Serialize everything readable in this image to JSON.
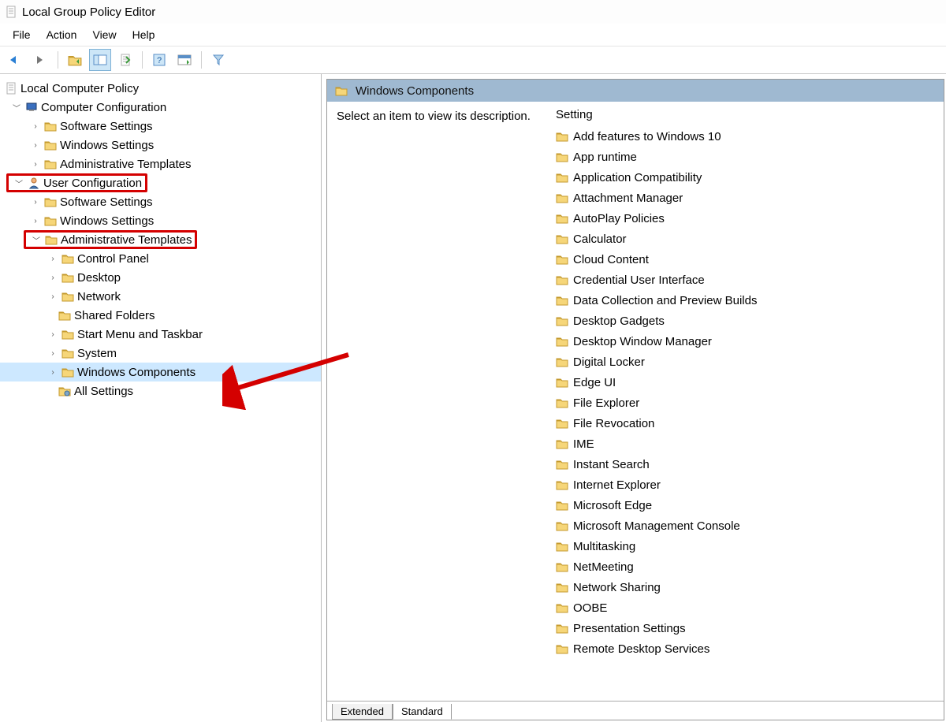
{
  "window": {
    "title": "Local Group Policy Editor"
  },
  "menu": {
    "file": "File",
    "action": "Action",
    "view": "View",
    "help": "Help"
  },
  "tree": {
    "root": "Local Computer Policy",
    "computer": "Computer Configuration",
    "comp_software": "Software Settings",
    "comp_windows": "Windows Settings",
    "comp_admin": "Administrative Templates",
    "user": "User Configuration",
    "user_software": "Software Settings",
    "user_windows": "Windows Settings",
    "user_admin": "Administrative Templates",
    "control_panel": "Control Panel",
    "desktop": "Desktop",
    "network": "Network",
    "shared_folders": "Shared Folders",
    "start_menu": "Start Menu and Taskbar",
    "system": "System",
    "windows_components": "Windows Components",
    "all_settings": "All Settings"
  },
  "right": {
    "header": "Windows Components",
    "desc": "Select an item to view its description.",
    "colheader": "Setting",
    "items": [
      "Add features to Windows 10",
      "App runtime",
      "Application Compatibility",
      "Attachment Manager",
      "AutoPlay Policies",
      "Calculator",
      "Cloud Content",
      "Credential User Interface",
      "Data Collection and Preview Builds",
      "Desktop Gadgets",
      "Desktop Window Manager",
      "Digital Locker",
      "Edge UI",
      "File Explorer",
      "File Revocation",
      "IME",
      "Instant Search",
      "Internet Explorer",
      "Microsoft Edge",
      "Microsoft Management Console",
      "Multitasking",
      "NetMeeting",
      "Network Sharing",
      "OOBE",
      "Presentation Settings",
      "Remote Desktop Services"
    ]
  },
  "tabs": {
    "extended": "Extended",
    "standard": "Standard"
  }
}
